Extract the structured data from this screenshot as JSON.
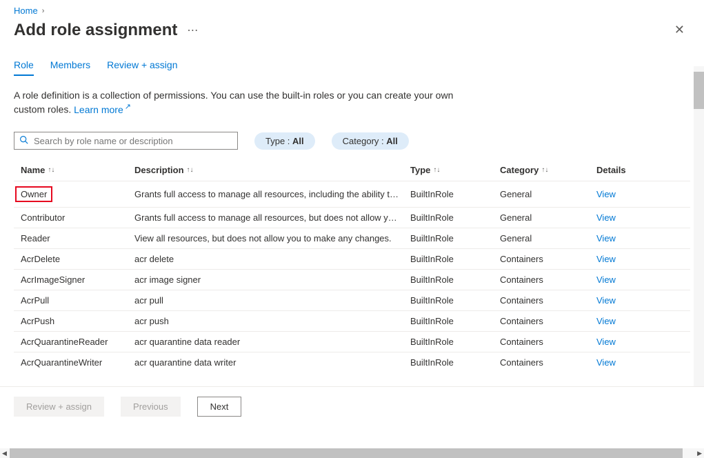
{
  "breadcrumb": {
    "home": "Home"
  },
  "header": {
    "title": "Add role assignment"
  },
  "tabs": [
    {
      "label": "Role",
      "active": true
    },
    {
      "label": "Members",
      "active": false
    },
    {
      "label": "Review + assign",
      "active": false
    }
  ],
  "description": {
    "text": "A role definition is a collection of permissions. You can use the built-in roles or you can create your own custom roles.",
    "learn_more": "Learn more"
  },
  "search": {
    "placeholder": "Search by role name or description"
  },
  "filters": {
    "type_label": "Type : ",
    "type_value": "All",
    "category_label": "Category : ",
    "category_value": "All"
  },
  "columns": {
    "name": "Name",
    "description": "Description",
    "type": "Type",
    "category": "Category",
    "details": "Details"
  },
  "view_label": "View",
  "rows": [
    {
      "name": "Owner",
      "description": "Grants full access to manage all resources, including the ability to a…",
      "type": "BuiltInRole",
      "category": "General",
      "highlight": true
    },
    {
      "name": "Contributor",
      "description": "Grants full access to manage all resources, but does not allow you …",
      "type": "BuiltInRole",
      "category": "General"
    },
    {
      "name": "Reader",
      "description": "View all resources, but does not allow you to make any changes.",
      "type": "BuiltInRole",
      "category": "General"
    },
    {
      "name": "AcrDelete",
      "description": "acr delete",
      "type": "BuiltInRole",
      "category": "Containers"
    },
    {
      "name": "AcrImageSigner",
      "description": "acr image signer",
      "type": "BuiltInRole",
      "category": "Containers"
    },
    {
      "name": "AcrPull",
      "description": "acr pull",
      "type": "BuiltInRole",
      "category": "Containers"
    },
    {
      "name": "AcrPush",
      "description": "acr push",
      "type": "BuiltInRole",
      "category": "Containers"
    },
    {
      "name": "AcrQuarantineReader",
      "description": "acr quarantine data reader",
      "type": "BuiltInRole",
      "category": "Containers"
    },
    {
      "name": "AcrQuarantineWriter",
      "description": "acr quarantine data writer",
      "type": "BuiltInRole",
      "category": "Containers"
    }
  ],
  "footer": {
    "review_assign": "Review + assign",
    "previous": "Previous",
    "next": "Next"
  }
}
